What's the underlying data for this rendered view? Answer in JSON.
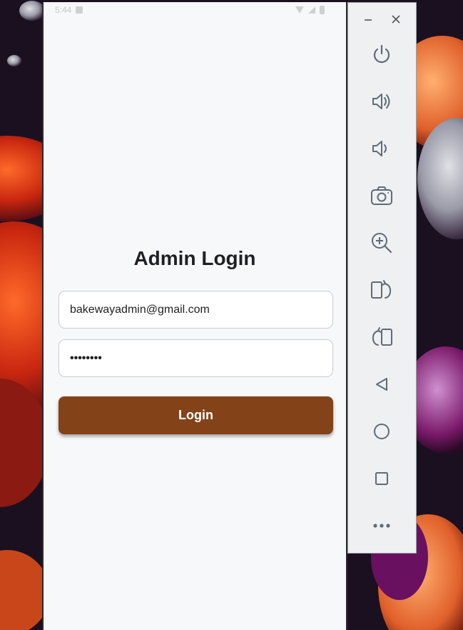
{
  "status_bar": {
    "time": "5:44"
  },
  "login": {
    "title": "Admin Login",
    "email_value": "bakewayadmin@gmail.com",
    "password_value": "••••••••",
    "login_label": "Login"
  },
  "colors": {
    "primary_button": "#834217",
    "screen_background": "#f7f8fa",
    "toolbar_background": "#eef0f2"
  },
  "toolbar": {
    "icons": [
      "minimize-icon",
      "close-icon",
      "power-icon",
      "volume-up-icon",
      "volume-down-icon",
      "camera-icon",
      "zoom-in-icon",
      "rotate-left-icon",
      "rotate-right-icon",
      "back-icon",
      "home-icon",
      "overview-icon",
      "more-icon"
    ]
  }
}
